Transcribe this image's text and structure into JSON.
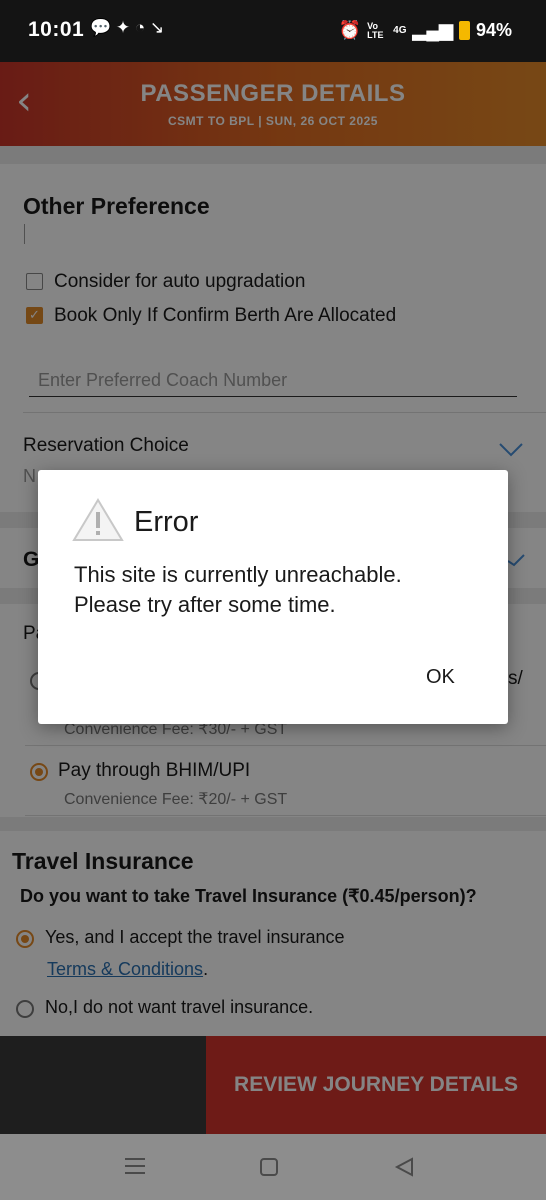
{
  "status_bar": {
    "time": "10:01",
    "battery_pct": "94%",
    "net_label": "Vo LTE",
    "net_gen": "4G"
  },
  "header": {
    "title": "PASSENGER DETAILS",
    "subtitle": "CSMT TO BPL |  SUN, 26 OCT  2025"
  },
  "other_preference": {
    "heading": "Other Preference",
    "auto_upgrade_label": "Consider for auto upgradation",
    "confirm_berth_label": "Book Only If Confirm Berth Are Allocated",
    "coach_placeholder": "Enter Preferred Coach Number"
  },
  "reservation": {
    "label": "Reservation Choice",
    "value": "N"
  },
  "gst_partial": "G",
  "payment": {
    "partial_label": "Pa",
    "option1_fee": "Convenience Fee: ₹30/- + GST",
    "option1_tail": "s/",
    "upi_label": "Pay through BHIM/UPI",
    "upi_fee": "Convenience Fee: ₹20/- + GST"
  },
  "insurance": {
    "heading": "Travel Insurance",
    "question": "Do you want to take Travel Insurance (₹0.45/person)?",
    "yes_label": "Yes, and I accept the travel insurance",
    "terms_link": "Terms & Conditions",
    "terms_suffix": ".",
    "no_label": "No,I do not want travel insurance."
  },
  "footer": {
    "review_button": "REVIEW JOURNEY DETAILS"
  },
  "dialog": {
    "title": "Error",
    "message_line1": "This site is currently unreachable.",
    "message_line2": "Please try after some time.",
    "ok_label": "OK"
  },
  "colors": {
    "accent": "#e58a2a",
    "header_start": "#c9352a",
    "link": "#2a6fb0",
    "review_bg": "#c9352a"
  }
}
